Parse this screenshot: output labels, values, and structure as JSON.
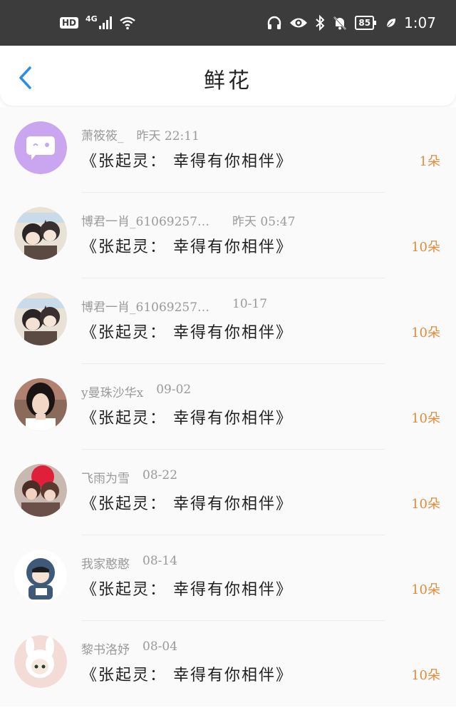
{
  "status_bar": {
    "hd": "HD",
    "network": "4G",
    "battery": "85",
    "time": "1:07"
  },
  "header": {
    "title": "鲜花"
  },
  "items": [
    {
      "user": "萧筱筱_",
      "time": "昨天 22:11",
      "book": "《张起灵： 幸得有你相伴》",
      "count": "1朵",
      "avatar": "chat-bubble-avatar"
    },
    {
      "user": "博君一肖_61069257…",
      "time": "昨天 05:47",
      "book": "《张起灵： 幸得有你相伴》",
      "count": "10朵",
      "avatar": "anime-duo-avatar"
    },
    {
      "user": "博君一肖_61069257…",
      "time": "10-17",
      "book": "《张起灵： 幸得有你相伴》",
      "count": "10朵",
      "avatar": "anime-duo-avatar"
    },
    {
      "user": "y曼珠沙华x",
      "time": "09-02",
      "book": "《张起灵： 幸得有你相伴》",
      "count": "10朵",
      "avatar": "photo-girl-avatar"
    },
    {
      "user": "飞雨为雪",
      "time": "08-22",
      "book": "《张起灵： 幸得有你相伴》",
      "count": "10朵",
      "avatar": "anime-couple-avatar"
    },
    {
      "user": "我家憨憨",
      "time": "08-14",
      "book": "《张起灵： 幸得有你相伴》",
      "count": "10朵",
      "avatar": "hooded-boy-avatar"
    },
    {
      "user": "黎书洛妤",
      "time": "08-04",
      "book": "《张起灵： 幸得有你相伴》",
      "count": "10朵",
      "avatar": "bunny-hood-avatar"
    }
  ]
}
